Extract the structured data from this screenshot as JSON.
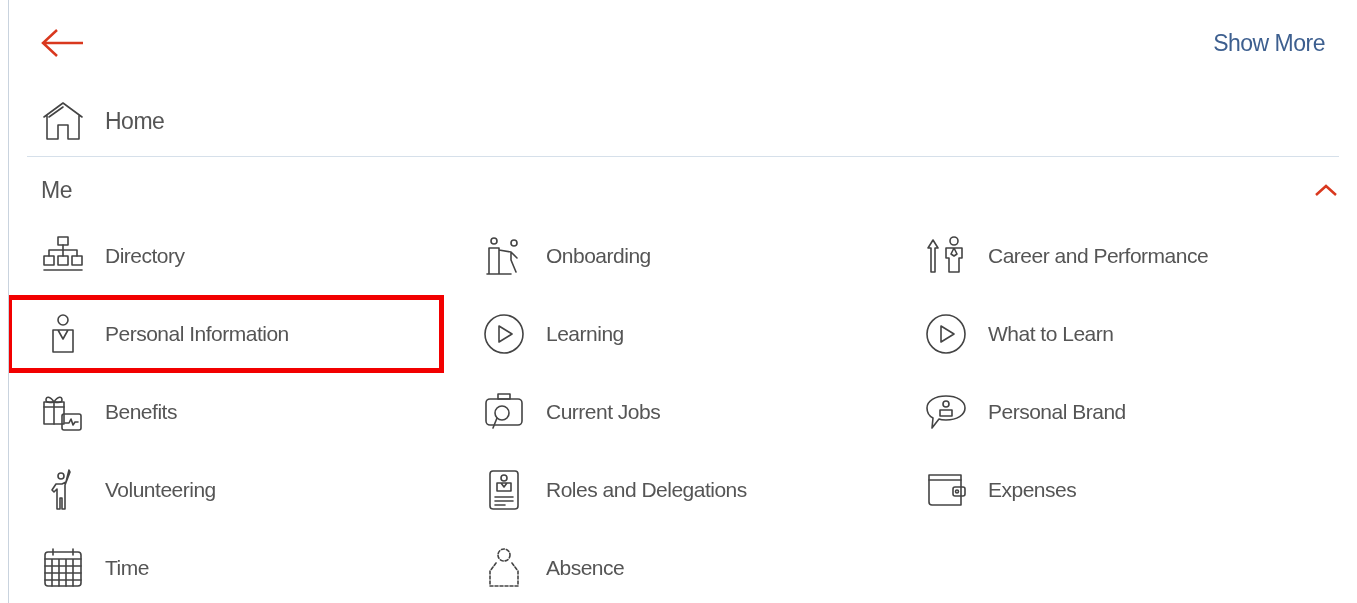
{
  "header": {
    "show_more": "Show More"
  },
  "home": {
    "label": "Home"
  },
  "section": {
    "title": "Me",
    "expanded": true,
    "items": [
      {
        "label": "Directory",
        "highlighted": false
      },
      {
        "label": "Onboarding",
        "highlighted": false
      },
      {
        "label": "Career and Performance",
        "highlighted": false
      },
      {
        "label": "Personal Information",
        "highlighted": true
      },
      {
        "label": "Learning",
        "highlighted": false
      },
      {
        "label": "What to Learn",
        "highlighted": false
      },
      {
        "label": "Benefits",
        "highlighted": false
      },
      {
        "label": "Current Jobs",
        "highlighted": false
      },
      {
        "label": "Personal Brand",
        "highlighted": false
      },
      {
        "label": "Volunteering",
        "highlighted": false
      },
      {
        "label": "Roles and Delegations",
        "highlighted": false
      },
      {
        "label": "Expenses",
        "highlighted": false
      },
      {
        "label": "Time",
        "highlighted": false
      },
      {
        "label": "Absence",
        "highlighted": false
      }
    ]
  }
}
